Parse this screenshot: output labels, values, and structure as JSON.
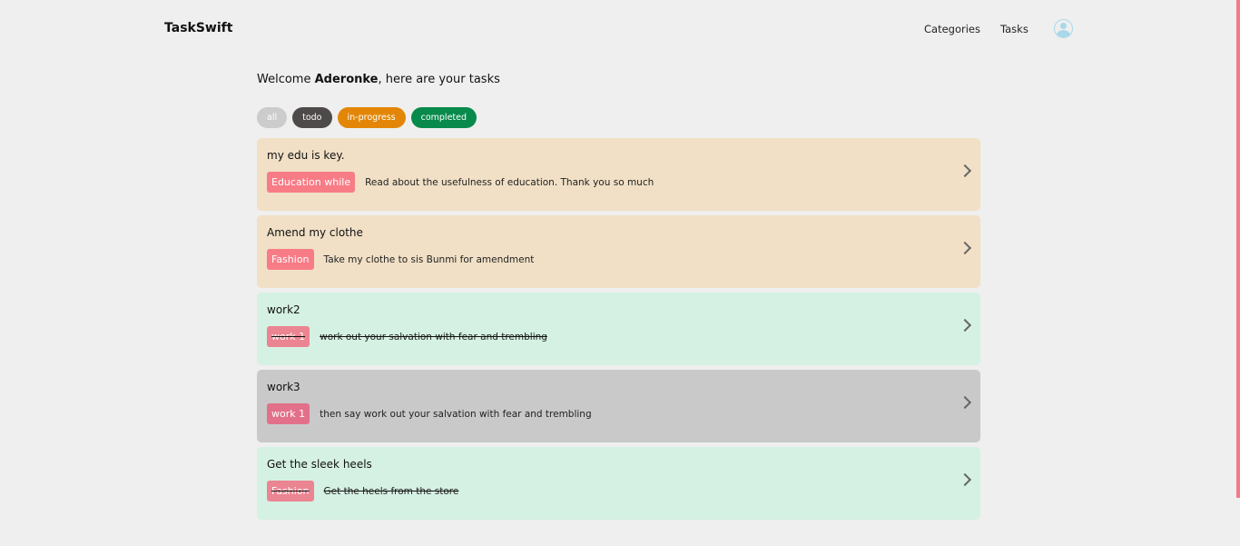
{
  "header": {
    "brand": "TaskSwift",
    "nav": [
      "Categories",
      "Tasks"
    ],
    "avatar_icon": "user-circle-icon"
  },
  "welcome": {
    "prefix": "Welcome ",
    "name": "Aderonke",
    "suffix": ", here are your tasks"
  },
  "filters": [
    {
      "label": "all",
      "color": "#cccccc"
    },
    {
      "label": "todo",
      "color": "#4f4a4a"
    },
    {
      "label": "in-progress",
      "color": "#e38607"
    },
    {
      "label": "completed",
      "color": "#078a4b"
    }
  ],
  "tasks": [
    {
      "title": "my edu is key.",
      "category": "Education while",
      "description": "Read about the usefulness of education. Thank you so much",
      "status": "in-progress",
      "bg": "#f1e0c6",
      "tag_color": "#f77c86"
    },
    {
      "title": "Amend my clothe",
      "category": "Fashion",
      "description": "Take my clothe to sis Bunmi for amendment",
      "status": "in-progress",
      "bg": "#f1e0c6",
      "tag_color": "#f77c86"
    },
    {
      "title": "work2",
      "category": "work 1",
      "description": "work out your salvation with fear and trembling",
      "status": "completed",
      "bg": "#d5f1e3",
      "tag_color": "#eb8591"
    },
    {
      "title": "work3",
      "category": "work 1",
      "description": "then say work out your salvation with fear and trembling",
      "status": "todo",
      "bg": "#c9c9c9",
      "tag_color": "#e3708a"
    },
    {
      "title": "Get the sleek heels",
      "category": "Fashion",
      "description": "Get the heels from the store",
      "status": "completed",
      "bg": "#d5f1e3",
      "tag_color": "#eb8591"
    }
  ]
}
